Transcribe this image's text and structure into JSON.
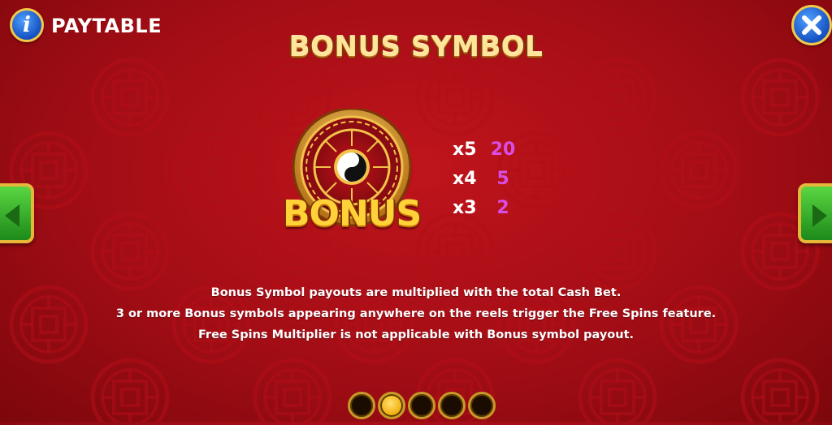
{
  "header": {
    "info_icon_glyph": "i",
    "title": "PAYTABLE",
    "close_icon": "close-x-icon"
  },
  "page": {
    "heading": "BONUS SYMBOL"
  },
  "symbol": {
    "name": "BONUS",
    "icon": "zodiac-wheel-yin-yang-icon"
  },
  "payouts": [
    {
      "count": "x5",
      "value": "20"
    },
    {
      "count": "x4",
      "value": "5"
    },
    {
      "count": "x3",
      "value": "2"
    }
  ],
  "description": [
    "Bonus Symbol payouts are multiplied with the total Cash Bet.",
    "3 or more Bonus symbols appearing anywhere on the reels trigger the Free Spins feature.",
    "Free Spins Multiplier is not applicable with Bonus symbol payout."
  ],
  "pagination": {
    "total": 5,
    "active_index": 1
  },
  "colors": {
    "background": "#b0101a",
    "title_gold": "#ffe49a",
    "payout_value": "#d94de6",
    "button_blue": "#1550c0",
    "nav_green": "#2faa24"
  }
}
